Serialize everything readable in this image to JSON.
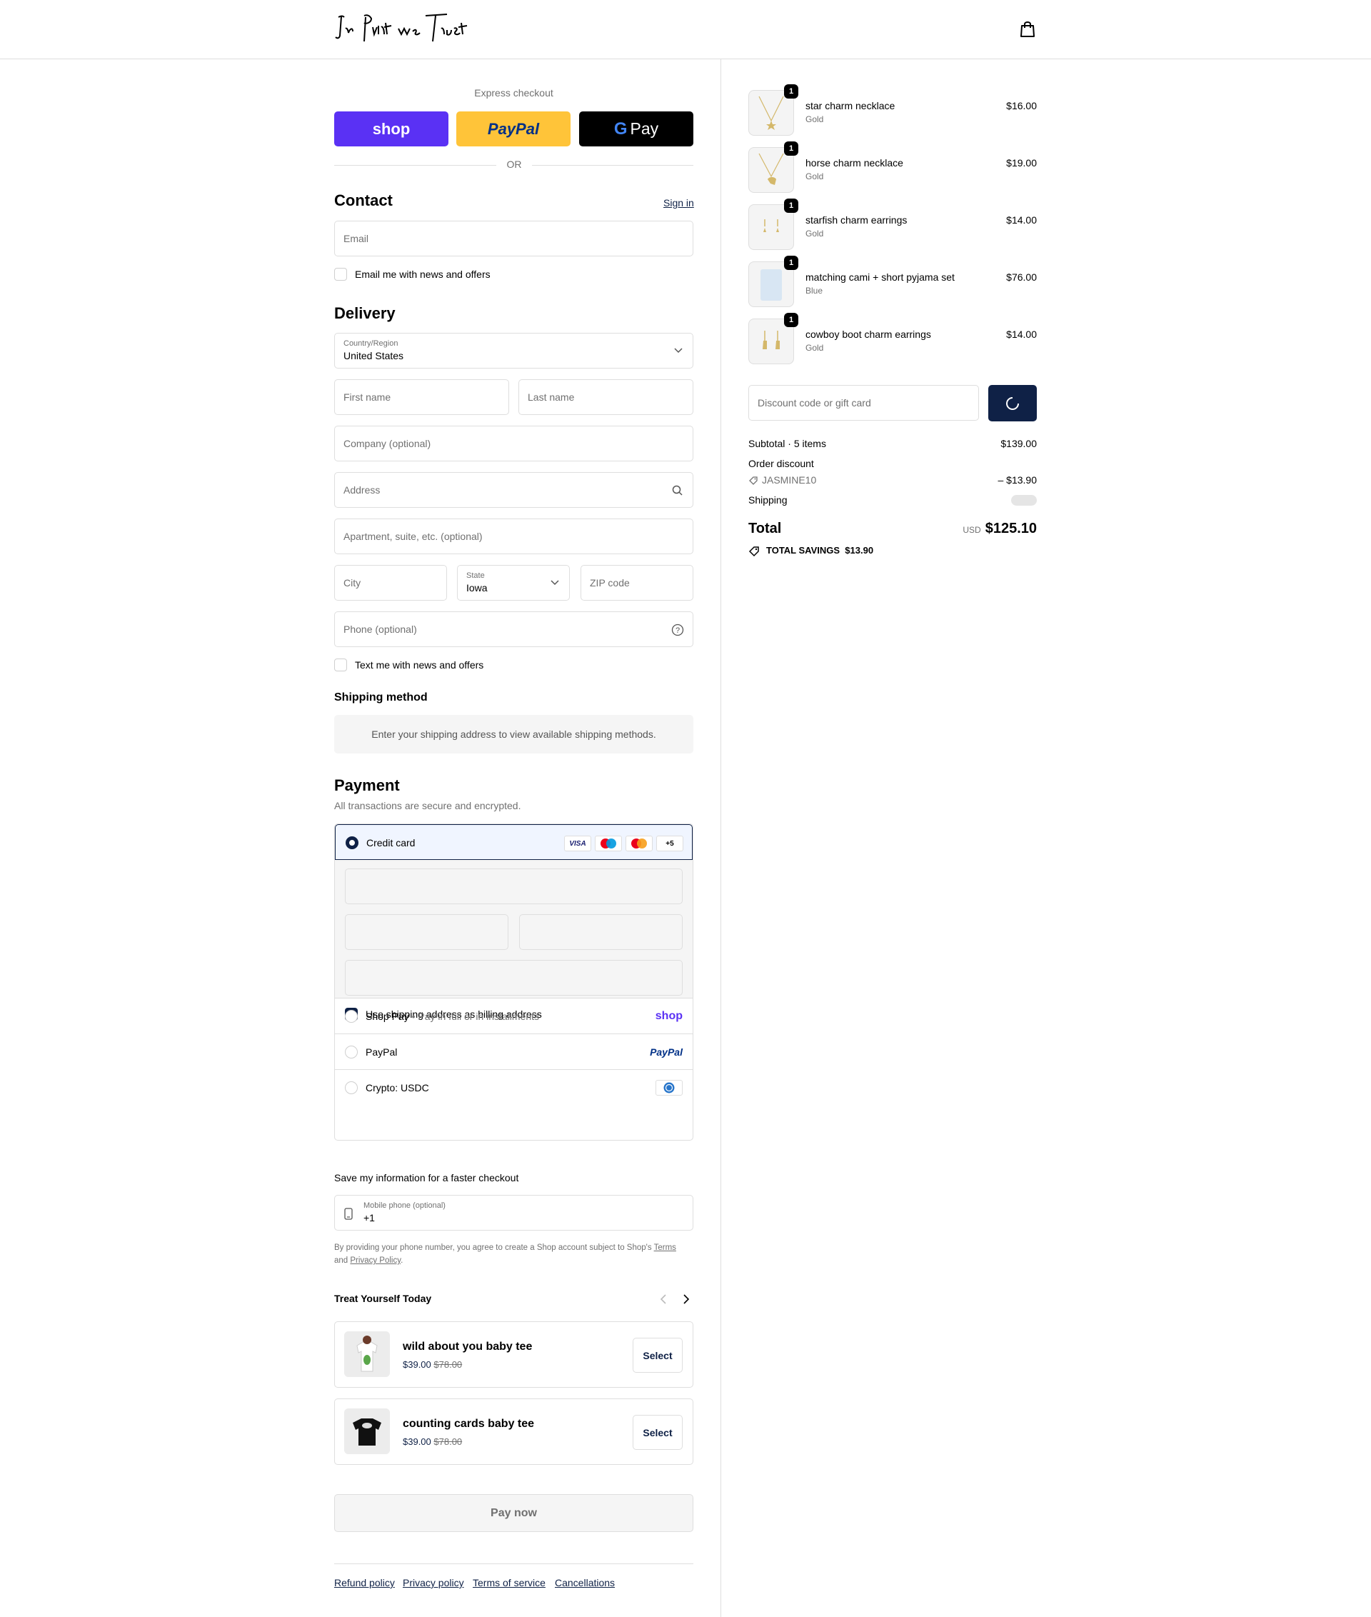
{
  "header": {
    "logo_text": "In Print we Trust",
    "cart_icon": "shopping-bag-icon"
  },
  "express": {
    "title": "Express checkout",
    "shop_label": "shop",
    "paypal_label": "PayPal",
    "gpay_label": "Pay",
    "or_label": "OR"
  },
  "contact": {
    "title": "Contact",
    "sign_in": "Sign in",
    "email_placeholder": "Email",
    "newsletter_label": "Email me with news and offers"
  },
  "delivery": {
    "title": "Delivery",
    "country_label": "Country/Region",
    "country_value": "United States",
    "first_name": "First name",
    "last_name": "Last name",
    "company": "Company (optional)",
    "address": "Address",
    "apartment": "Apartment, suite, etc. (optional)",
    "city": "City",
    "state_label": "State",
    "state_value": "Iowa",
    "zip": "ZIP code",
    "phone": "Phone (optional)",
    "sms_label": "Text me with news and offers"
  },
  "shipping": {
    "title": "Shipping method",
    "notice": "Enter your shipping address to view available shipping methods."
  },
  "payment": {
    "title": "Payment",
    "subtitle": "All transactions are secure and encrypted.",
    "credit_card": "Credit card",
    "more_cards": "+5",
    "visa": "VISA",
    "billing_label": "Use shipping address as billing address",
    "shop_pay": "Shop Pay",
    "shop_pay_sub": "Pay in full or in installments",
    "shop_pay_logo": "shop",
    "paypal": "PayPal",
    "paypal_logo": "PayPal",
    "crypto": "Crypto: USDC"
  },
  "save_info": {
    "title": "Save my information for a faster checkout",
    "mobile_label": "Mobile phone (optional)",
    "mobile_value": "+1",
    "disclaimer_pre": "By providing your phone number, you agree to create a Shop account subject to Shop's",
    "terms": "Terms",
    "and": "and",
    "privacy": "Privacy Policy",
    "period": "."
  },
  "recommendations": {
    "title": "Treat Yourself Today",
    "items": [
      {
        "name": "wild about you baby tee",
        "price": "$39.00",
        "compare_price": "$78.00",
        "button": "Select"
      },
      {
        "name": "counting cards baby tee",
        "price": "$39.00",
        "compare_price": "$78.00",
        "button": "Select"
      }
    ]
  },
  "pay_now": "Pay now",
  "footer": {
    "links": [
      "Refund policy",
      "Privacy policy",
      "Terms of service",
      "Cancellations"
    ]
  },
  "order": {
    "items": [
      {
        "qty": "1",
        "name": "star charm necklace",
        "variant": "Gold",
        "price": "$16.00"
      },
      {
        "qty": "1",
        "name": "horse charm necklace",
        "variant": "Gold",
        "price": "$19.00"
      },
      {
        "qty": "1",
        "name": "starfish charm earrings",
        "variant": "Gold",
        "price": "$14.00"
      },
      {
        "qty": "1",
        "name": "matching cami + short pyjama set",
        "variant": "Blue",
        "price": "$76.00"
      },
      {
        "qty": "1",
        "name": "cowboy boot charm earrings",
        "variant": "Gold",
        "price": "$14.00"
      }
    ],
    "discount_placeholder": "Discount code or gift card",
    "subtotal_label": "Subtotal · 5 items",
    "subtotal_value": "$139.00",
    "order_discount_label": "Order discount",
    "discount_code": "JASMINE10",
    "discount_value": "– $13.90",
    "shipping_label": "Shipping",
    "total_label": "Total",
    "currency": "USD",
    "total_value": "$125.10",
    "savings_label": "TOTAL SAVINGS",
    "savings_value": "$13.90"
  },
  "colors": {
    "brand_navy": "#0f2146",
    "shop_purple": "#5a31f4",
    "paypal_yellow": "#ffc439"
  }
}
